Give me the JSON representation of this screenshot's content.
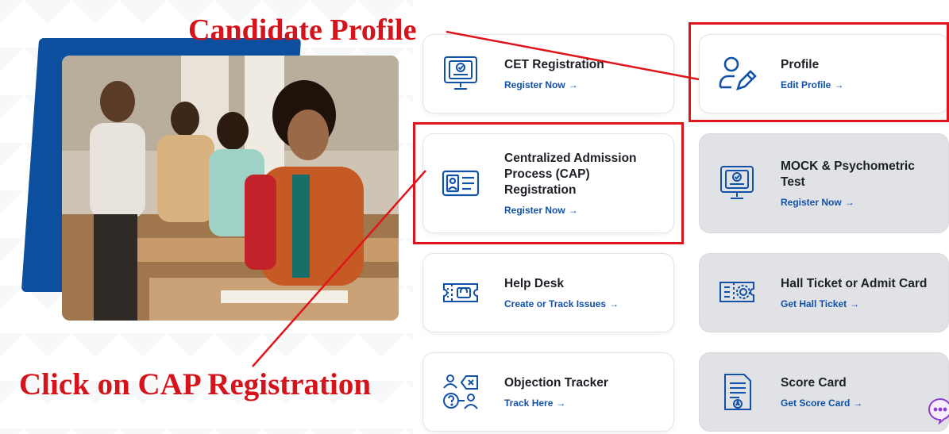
{
  "annotations": {
    "candidate_profile": "Candidate Profile",
    "click_cap": "Click on CAP Registration"
  },
  "cards": {
    "cet": {
      "title": "CET Registration",
      "link": "Register Now",
      "icon": "monitor-certificate-icon"
    },
    "profile": {
      "title": "Profile",
      "link": "Edit Profile",
      "icon": "user-edit-icon"
    },
    "cap": {
      "title": "Centralized Admission Process (CAP) Registration",
      "link": "Register Now",
      "icon": "id-card-icon"
    },
    "mock": {
      "title": "MOCK & Psychometric Test",
      "link": "Register Now",
      "icon": "monitor-certificate-icon"
    },
    "help": {
      "title": "Help Desk",
      "link": "Create or Track Issues",
      "icon": "ticket-helpdesk-icon"
    },
    "hall": {
      "title": "Hall Ticket or Admit Card",
      "link": "Get Hall Ticket",
      "icon": "ticket-gear-icon"
    },
    "objection": {
      "title": "Objection Tracker",
      "link": "Track Here",
      "icon": "objection-users-icon"
    },
    "score": {
      "title": "Score Card",
      "link": "Get Score Card",
      "icon": "score-document-icon"
    }
  },
  "arrow": "→",
  "colors": {
    "accent": "#1151a8",
    "annotation_red": "#e0151b",
    "hero_blue": "#0b4f9e",
    "card_gray": "#e1e2e5"
  }
}
